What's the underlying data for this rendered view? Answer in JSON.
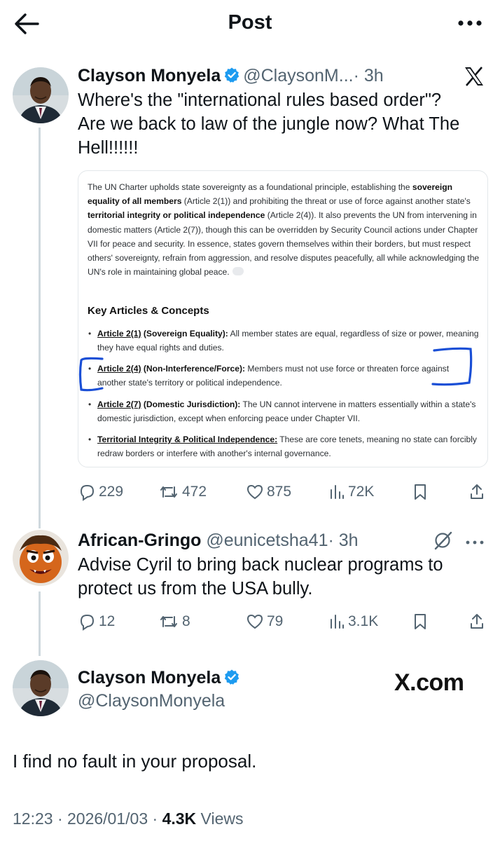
{
  "header": {
    "title": "Post"
  },
  "post": {
    "author_name": "Clayson Monyela",
    "handle": "@ClaysonM...",
    "time": "· 3h",
    "text_lines": [
      "Where's the \"international rules based order\"?",
      "Are we back to law of the jungle now? What The",
      "Hell!!!!!!"
    ],
    "embed": {
      "intro_parts": [
        "The UN Charter upholds state sovereignty as a foundational principle, establishing the ",
        "sovereign equality of all members",
        " (Article 2(1)) and prohibiting the threat or use of force against another state's ",
        "territorial integrity or political independence",
        " (Article 2(4)). It also prevents the UN from intervening in domestic matters (Article 2(7)), though this can be overridden by Security Council actions under Chapter VII for peace and security. In essence, states govern themselves within their borders, but must respect others' sovereignty, refrain from aggression, and resolve disputes peacefully, all while acknowledging the UN's role in maintaining global peace."
      ],
      "section_title": "Key Articles & Concepts",
      "bullets": [
        {
          "term": "Article 2(1)",
          "term_rest": " (Sovereign Equality):",
          "text": " All member states are equal, regardless of size or power, meaning they have equal rights and duties."
        },
        {
          "term": "Article 2(4)",
          "term_rest": " (Non-Interference/Force):",
          "text": " Members must not use force or threaten force against another state's territory or political independence."
        },
        {
          "term": "Article 2(7)",
          "term_rest": " (Domestic Jurisdiction):",
          "text": " The UN cannot intervene in matters essentially within a state's domestic jurisdiction, except when enforcing peace under Chapter VII."
        },
        {
          "term": "Territorial Integrity & Political Independence:",
          "term_rest": "",
          "text": " These are core tenets, meaning no state can forcibly redraw borders or interfere with another's internal governance."
        }
      ]
    },
    "stats": {
      "replies": "229",
      "reposts": "472",
      "likes": "875",
      "views": "72K"
    }
  },
  "reply1": {
    "author_name": "African-Gringo",
    "handle": "@eunicetsha41",
    "time": "· 3h",
    "text_lines": [
      "Advise Cyril to bring back  nuclear programs to",
      "protect us from the USA bully."
    ],
    "stats": {
      "replies": "12",
      "reposts": "8",
      "likes": "79",
      "views": "3.1K"
    }
  },
  "reply2": {
    "author_name": "Clayson Monyela",
    "handle": "@ClaysonMonyela",
    "watermark": "X.com",
    "text": "I find no fault in your proposal.",
    "meta_prefix": "12:23 · 2026/01/03 · ",
    "views_count": "4.3K",
    "views_label": " Views"
  },
  "colors": {
    "text": "#0f1419",
    "secondary": "#536471",
    "verified": "#1d9bf0",
    "annotation_pen": "#1a4fd6",
    "divider": "#cfd9de"
  }
}
